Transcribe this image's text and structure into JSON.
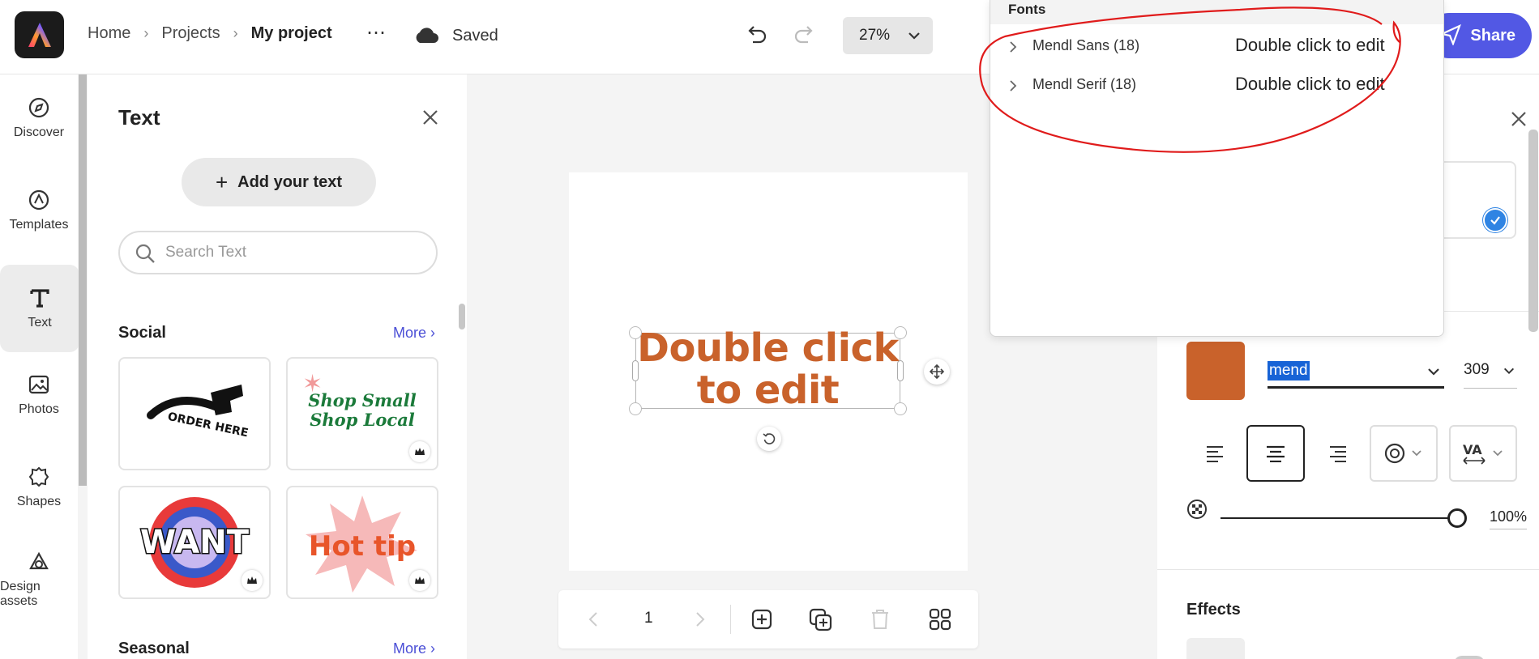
{
  "header": {
    "breadcrumbs": [
      "Home",
      "Projects",
      "My project"
    ],
    "more_icon": "⋯",
    "save_status": "Saved",
    "zoom": "27%",
    "share_label": "Share",
    "brand_color": "#5258e4"
  },
  "rail": {
    "items": [
      {
        "label": "Discover",
        "icon": "compass-icon"
      },
      {
        "label": "Templates",
        "icon": "templates-icon"
      },
      {
        "label": "Text",
        "icon": "text-icon",
        "active": true
      },
      {
        "label": "Photos",
        "icon": "photo-icon"
      },
      {
        "label": "Shapes",
        "icon": "shapes-icon"
      },
      {
        "label": "Design assets",
        "icon": "design-assets-icon"
      }
    ]
  },
  "text_panel": {
    "title": "Text",
    "add_text_label": "Add your text",
    "search_placeholder": "Search Text",
    "sections": [
      {
        "title": "Social",
        "more": "More",
        "tiles": [
          "ORDER HERE",
          "Shop Small Shop Local",
          "WANT",
          "Hot tip"
        ]
      },
      {
        "title": "Seasonal",
        "more": "More"
      }
    ]
  },
  "canvas": {
    "text": "Double click to edit",
    "text_line1": "Double click",
    "text_line2": "to edit",
    "text_color": "#c9622b"
  },
  "page_nav": {
    "page_number": "1"
  },
  "properties": {
    "font_query": "mend",
    "font_size": "309",
    "opacity": "100%",
    "effects_title": "Effects",
    "color": "#c9622b"
  },
  "fonts_dropdown": {
    "header": "Fonts",
    "items": [
      {
        "name": "Mendl Sans (18)",
        "sample": "Double click to edit"
      },
      {
        "name": "Mendl Serif (18)",
        "sample": "Double click to edit"
      }
    ]
  }
}
